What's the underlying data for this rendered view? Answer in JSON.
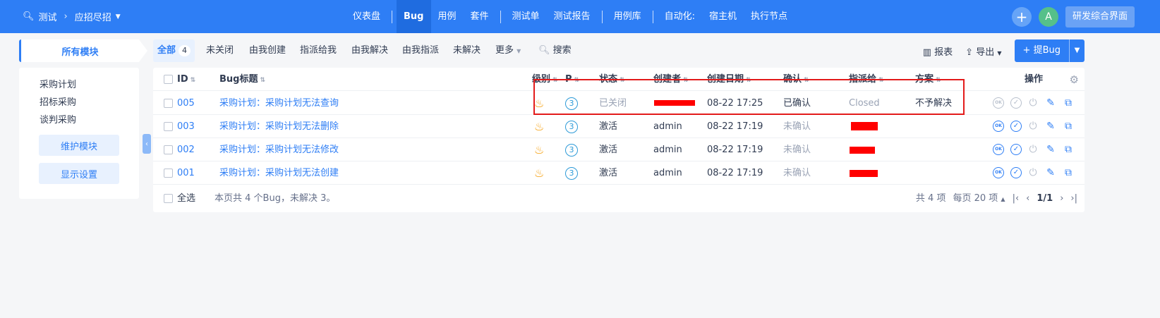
{
  "header": {
    "product": "测试",
    "project": "应招尽招",
    "nav": [
      "仪表盘",
      "Bug",
      "用例",
      "套件",
      "测试单",
      "测试报告",
      "用例库",
      "自动化:",
      "宿主机",
      "执行节点"
    ],
    "active_nav": "Bug",
    "avatar": "A",
    "workspace": "研发综合界面"
  },
  "sidebar": {
    "title": "所有模块",
    "modules": [
      "采购计划",
      "招标采购",
      "谈判采购"
    ],
    "maintain": "维护模块",
    "display": "显示设置"
  },
  "toolbar": {
    "filters": [
      "全部",
      "未关闭",
      "由我创建",
      "指派给我",
      "由我解决",
      "由我指派",
      "未解决",
      "更多",
      "搜索"
    ],
    "all_count": "4",
    "report": "报表",
    "export": "导出",
    "create": "提Bug"
  },
  "table": {
    "headers": [
      "ID",
      "Bug标题",
      "级别",
      "P",
      "状态",
      "创建者",
      "创建日期",
      "确认",
      "指派给",
      "方案",
      "操作"
    ],
    "rows": [
      {
        "id": "005",
        "title": "采购计划：采购计划无法查询",
        "priority": "3",
        "status": "已关闭",
        "creator": "",
        "date": "08-22 17:25",
        "confirm": "已确认",
        "assigned": "Closed",
        "resolution": "不予解决"
      },
      {
        "id": "003",
        "title": "采购计划：采购计划无法删除",
        "priority": "3",
        "status": "激活",
        "creator": "admin",
        "date": "08-22 17:19",
        "confirm": "未确认",
        "assigned": "",
        "resolution": ""
      },
      {
        "id": "002",
        "title": "采购计划：采购计划无法修改",
        "priority": "3",
        "status": "激活",
        "creator": "admin",
        "date": "08-22 17:19",
        "confirm": "未确认",
        "assigned": "",
        "resolution": ""
      },
      {
        "id": "001",
        "title": "采购计划：采购计划无法创建",
        "priority": "3",
        "status": "激活",
        "creator": "admin",
        "date": "08-22 17:19",
        "confirm": "未确认",
        "assigned": "",
        "resolution": ""
      }
    ],
    "select_all": "全选",
    "summary": "本页共 4 个Bug，未解决 3。",
    "total": "共 4 项",
    "per_page": "每页 20 项",
    "page": "1/1"
  }
}
